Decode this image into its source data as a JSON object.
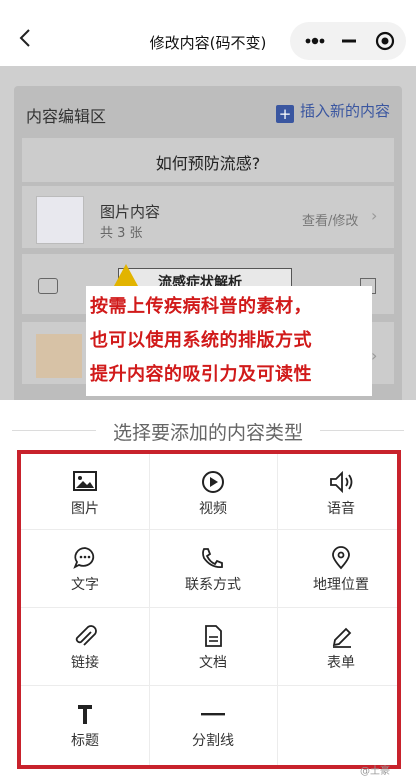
{
  "header": {
    "title": "修改内容(码不变)",
    "capsule_more_icon": "more-dots-icon",
    "capsule_minimize_icon": "minimize-icon",
    "capsule_close_icon": "record-target-icon"
  },
  "page": {
    "section_title": "内容编辑区",
    "insert_label": "插入新的内容",
    "question_title": "如何预防流感?",
    "image_item": {
      "title": "图片内容",
      "count": "共 3 张",
      "action": "查看/修改"
    },
    "warning_title": "流感症状解析"
  },
  "overlay": {
    "lines": [
      "按需上传疾病科普的素材，",
      "也可以使用系统的排版方式",
      "提升内容的吸引力及可读性"
    ]
  },
  "sheet": {
    "title": "选择要添加的内容类型",
    "items": [
      {
        "label": "图片",
        "icon": "image-icon"
      },
      {
        "label": "视频",
        "icon": "video-play-icon"
      },
      {
        "label": "语音",
        "icon": "speaker-icon"
      },
      {
        "label": "文字",
        "icon": "chat-bubble-icon"
      },
      {
        "label": "联系方式",
        "icon": "phone-icon"
      },
      {
        "label": "地理位置",
        "icon": "location-pin-icon"
      },
      {
        "label": "链接",
        "icon": "paperclip-icon"
      },
      {
        "label": "文档",
        "icon": "document-icon"
      },
      {
        "label": "表单",
        "icon": "pen-icon"
      },
      {
        "label": "标题",
        "icon": "title-t-icon"
      },
      {
        "label": "分割线",
        "icon": "divider-icon"
      }
    ]
  },
  "watermark": "@土豪"
}
